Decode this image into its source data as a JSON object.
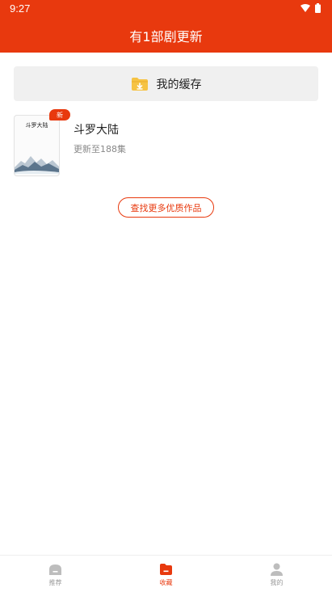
{
  "status": {
    "time": "9:27"
  },
  "header": {
    "title": "有1部剧更新"
  },
  "cache": {
    "label": "我的缓存",
    "icon": "folder-download-icon"
  },
  "item": {
    "cover_text": "斗罗大陆",
    "badge": "新",
    "title": "斗罗大陆",
    "subtitle": "更新至188集"
  },
  "more_button": "查找更多优质作品",
  "tabs": [
    {
      "label": "推荐",
      "icon": "home-icon",
      "active": false
    },
    {
      "label": "收藏",
      "icon": "folder-icon",
      "active": true
    },
    {
      "label": "我的",
      "icon": "user-icon",
      "active": false
    }
  ],
  "colors": {
    "accent": "#e8390e",
    "folder": "#f6c344",
    "muted": "#999999"
  }
}
